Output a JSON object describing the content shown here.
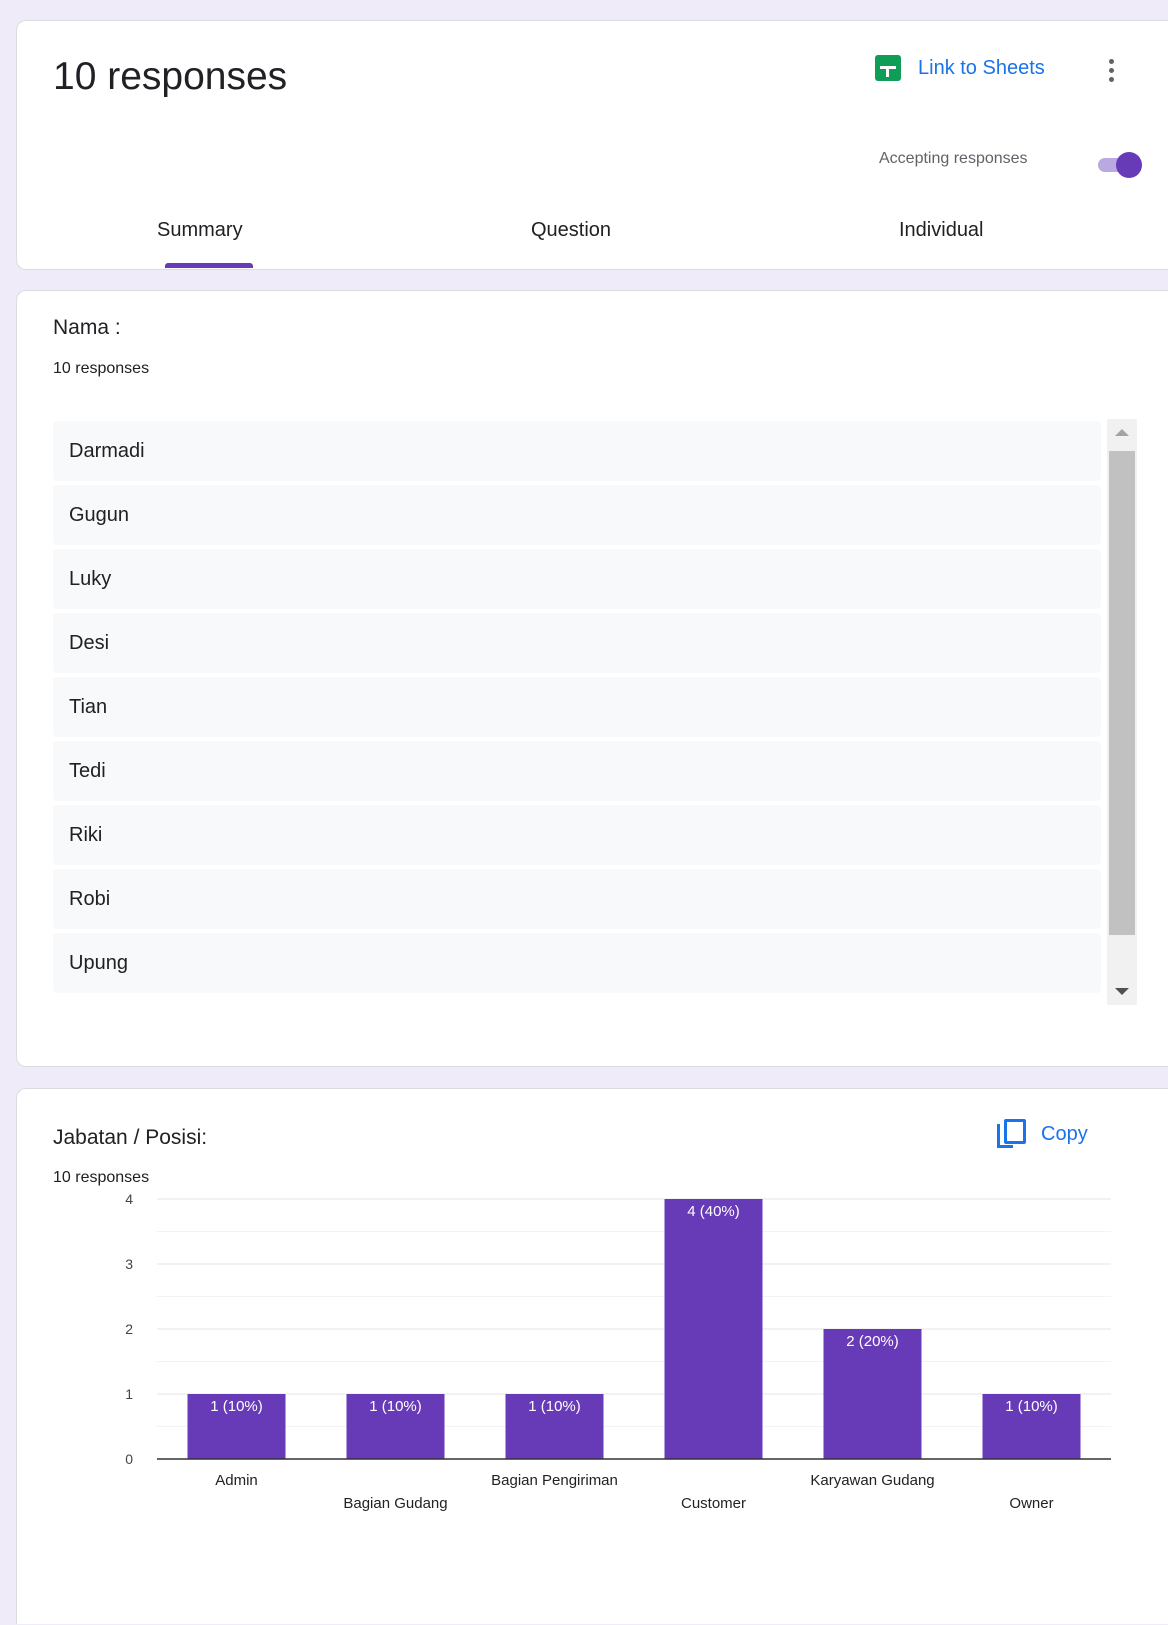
{
  "header": {
    "title": "10 responses",
    "link_to_sheets": "Link to Sheets",
    "accepting_label": "Accepting responses",
    "accepting": true,
    "tabs": [
      "Summary",
      "Question",
      "Individual"
    ],
    "active_tab": "Summary"
  },
  "nama": {
    "title": "Nama :",
    "count": "10 responses",
    "answers": [
      "Darmadi",
      "Gugun",
      "Luky",
      "Desi",
      "Tian",
      "Tedi",
      "Riki",
      "Robi",
      "Upung"
    ]
  },
  "jabatan": {
    "title": "Jabatan / Posisi:",
    "count": "10 responses",
    "copy_label": "Copy"
  },
  "colors": {
    "accent": "#673ab7",
    "link": "#1a73e8",
    "sheets": "#0f9d58"
  },
  "chart_data": {
    "type": "bar",
    "categories": [
      "Admin",
      "Bagian Gudang",
      "Bagian Pengiriman",
      "Customer",
      "Karyawan Gudang",
      "Owner"
    ],
    "values": [
      1,
      1,
      1,
      4,
      2,
      1
    ],
    "labels": [
      "1 (10%)",
      "1 (10%)",
      "1 (10%)",
      "4 (40%)",
      "2 (20%)",
      "1 (10%)"
    ],
    "yticks": [
      "0",
      "1",
      "2",
      "3",
      "4"
    ],
    "ylim": [
      0,
      4
    ],
    "bar_color": "#673ab7",
    "grid": true
  }
}
